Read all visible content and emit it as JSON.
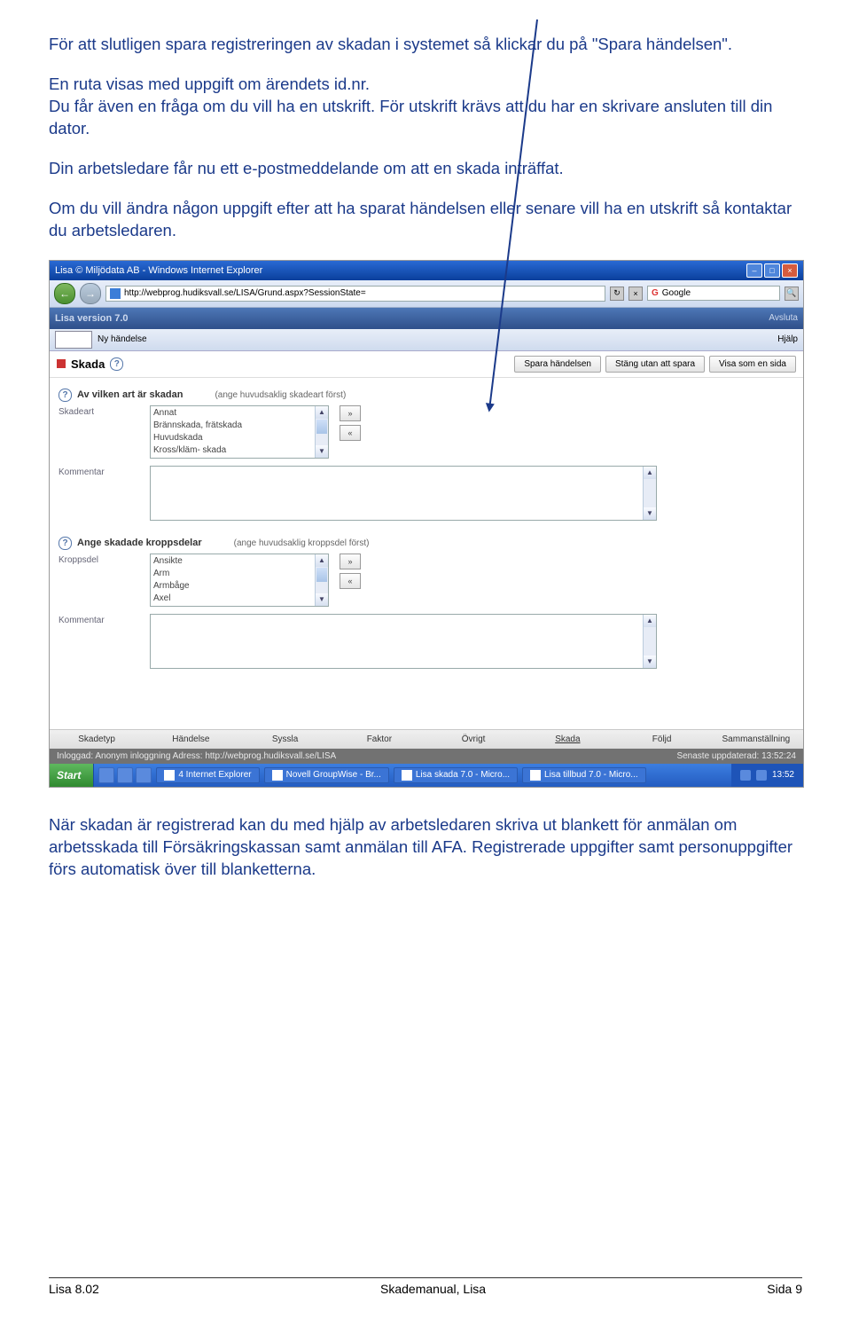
{
  "text": {
    "p1": "För att slutligen spara registreringen av skadan i systemet så klickar du på \"Spara händelsen\".",
    "p2": "En ruta visas med uppgift om ärendets id.nr.",
    "p3": "Du får även en fråga om du vill ha en utskrift. För utskrift krävs att du har en skrivare ansluten till din dator.",
    "p4": "Din arbetsledare får nu ett e-postmeddelande om att en skada inträffat.",
    "p5": "Om du vill ändra någon uppgift efter att ha sparat händelsen eller senare vill ha en utskrift så kontaktar du arbetsledaren.",
    "p6": "När skadan är registrerad kan du med hjälp av arbetsledaren skriva ut blankett för anmälan om arbetsskada till Försäkringskassan samt anmälan till AFA. Registrerade uppgifter samt personuppgifter förs automatisk över till blanketterna."
  },
  "ie": {
    "title": "Lisa © Miljödata AB - Windows Internet Explorer",
    "url": "http://webprog.hudiksvall.se/LISA/Grund.aspx?SessionState=",
    "search": "Google"
  },
  "app": {
    "version": "Lisa version 7.0",
    "avsluta": "Avsluta",
    "ny": "Ny händelse",
    "hjalp": "Hjälp"
  },
  "titlebar": {
    "title": "Skada",
    "btn_save": "Spara händelsen",
    "btn_cancel": "Stäng utan att spara",
    "btn_view": "Visa som en sida"
  },
  "form": {
    "q1": "Av vilken art är skadan",
    "q1_hint": "(ange huvudsaklig skadeart först)",
    "lbl_skadeart": "Skadeart",
    "list1": [
      "Annat",
      "Brännskada, frätskada",
      "Huvudskada",
      "Kross/kläm- skada"
    ],
    "lbl_kommentar": "Kommentar",
    "q2": "Ange skadade kroppsdelar",
    "q2_hint": "(ange huvudsaklig kroppsdel först)",
    "lbl_kroppsdel": "Kroppsdel",
    "list2": [
      "Ansikte",
      "Arm",
      "Armbåge",
      "Axel"
    ]
  },
  "tabs": [
    "Skadetyp",
    "Händelse",
    "Syssla",
    "Faktor",
    "Övrigt",
    "Skada",
    "Följd",
    "Sammanställning"
  ],
  "status": {
    "left": "Inloggad: Anonym inloggning  Adress: http://webprog.hudiksvall.se/LISA",
    "right": "Senaste uppdaterad: 13:52:24"
  },
  "taskbar": {
    "start": "Start",
    "t1": "4 Internet Explorer",
    "t2": "Novell GroupWise - Br...",
    "t3": "Lisa skada 7.0 - Micro...",
    "t4": "Lisa tillbud 7.0 - Micro...",
    "time": "13:52"
  },
  "footer": {
    "left": "Lisa 8.02",
    "mid": "Skademanual, Lisa",
    "right": "Sida 9"
  }
}
